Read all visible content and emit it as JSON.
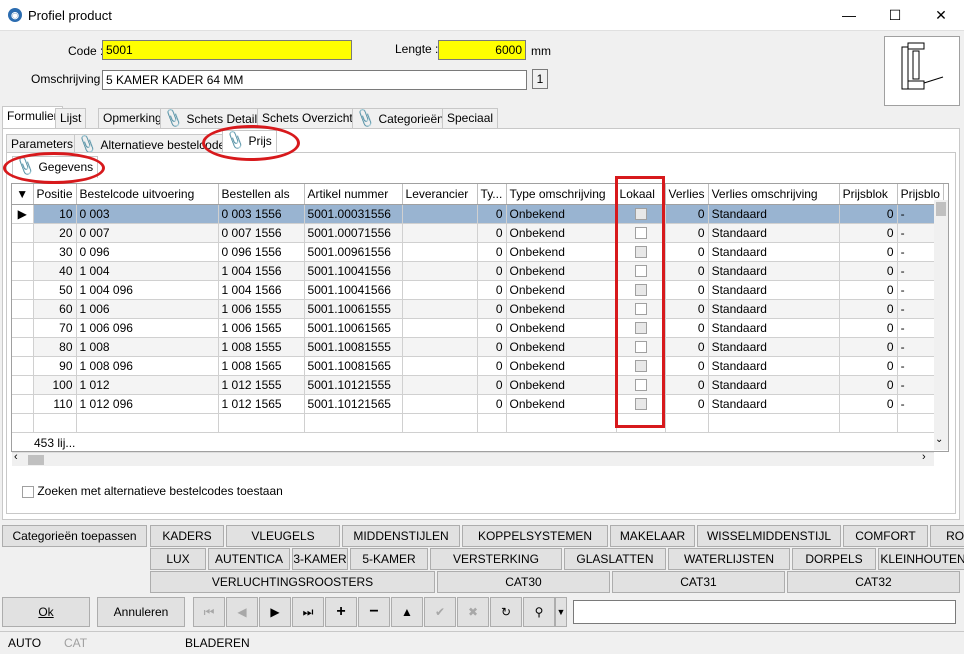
{
  "window": {
    "title": "Profiel product",
    "app_icon": "product-app-icon"
  },
  "header": {
    "code_label": "Code :",
    "code_value": "5001",
    "lengte_label": "Lengte :",
    "lengte_value": "6000",
    "lengte_unit": "mm",
    "omschrijving_label": "Omschrijving :",
    "omschrijving_value": "5 KAMER KADER 64 MM",
    "counter": "1"
  },
  "tabs": [
    "Formulier",
    "Lijst",
    "Opmerking",
    "Schets Detail",
    "Schets Overzicht",
    "Categorieën",
    "Speciaal"
  ],
  "subtabs": [
    "Parameters",
    "Alternatieve bestelcodes",
    "Prijs"
  ],
  "subsubtab": "Gegevens",
  "grid": {
    "columns": [
      "Positie",
      "Bestelcode uitvoering",
      "Bestellen als",
      "Artikel nummer",
      "Leverancier",
      "Ty...",
      "Type omschrijving",
      "Lokaal",
      "Verlies",
      "Verlies omschrijving",
      "Prijsblok",
      "Prijsblo"
    ],
    "rows": [
      {
        "pos": "10",
        "code": "0 003",
        "bestel": "0 003 1556",
        "art": "5001.00031556",
        "lev": "",
        "ty": "0",
        "type": "Onbekend",
        "verlies": "0",
        "vom": "Standaard",
        "prijsblok": "0",
        "pb2": "-"
      },
      {
        "pos": "20",
        "code": "0 007",
        "bestel": "0 007 1556",
        "art": "5001.00071556",
        "lev": "",
        "ty": "0",
        "type": "Onbekend",
        "verlies": "0",
        "vom": "Standaard",
        "prijsblok": "0",
        "pb2": "-"
      },
      {
        "pos": "30",
        "code": "0 096",
        "bestel": "0 096 1556",
        "art": "5001.00961556",
        "lev": "",
        "ty": "0",
        "type": "Onbekend",
        "verlies": "0",
        "vom": "Standaard",
        "prijsblok": "0",
        "pb2": "-"
      },
      {
        "pos": "40",
        "code": "1 004",
        "bestel": "1 004 1556",
        "art": "5001.10041556",
        "lev": "",
        "ty": "0",
        "type": "Onbekend",
        "verlies": "0",
        "vom": "Standaard",
        "prijsblok": "0",
        "pb2": "-"
      },
      {
        "pos": "50",
        "code": "1 004 096",
        "bestel": "1 004 1566",
        "art": "5001.10041566",
        "lev": "",
        "ty": "0",
        "type": "Onbekend",
        "verlies": "0",
        "vom": "Standaard",
        "prijsblok": "0",
        "pb2": "-"
      },
      {
        "pos": "60",
        "code": "1 006",
        "bestel": "1 006 1555",
        "art": "5001.10061555",
        "lev": "",
        "ty": "0",
        "type": "Onbekend",
        "verlies": "0",
        "vom": "Standaard",
        "prijsblok": "0",
        "pb2": "-"
      },
      {
        "pos": "70",
        "code": "1 006 096",
        "bestel": "1 006 1565",
        "art": "5001.10061565",
        "lev": "",
        "ty": "0",
        "type": "Onbekend",
        "verlies": "0",
        "vom": "Standaard",
        "prijsblok": "0",
        "pb2": "-"
      },
      {
        "pos": "80",
        "code": "1 008",
        "bestel": "1 008 1555",
        "art": "5001.10081555",
        "lev": "",
        "ty": "0",
        "type": "Onbekend",
        "verlies": "0",
        "vom": "Standaard",
        "prijsblok": "0",
        "pb2": "-"
      },
      {
        "pos": "90",
        "code": "1 008 096",
        "bestel": "1 008 1565",
        "art": "5001.10081565",
        "lev": "",
        "ty": "0",
        "type": "Onbekend",
        "verlies": "0",
        "vom": "Standaard",
        "prijsblok": "0",
        "pb2": "-"
      },
      {
        "pos": "100",
        "code": "1 012",
        "bestel": "1 012 1555",
        "art": "5001.10121555",
        "lev": "",
        "ty": "0",
        "type": "Onbekend",
        "verlies": "0",
        "vom": "Standaard",
        "prijsblok": "0",
        "pb2": "-"
      },
      {
        "pos": "110",
        "code": "1 012 096",
        "bestel": "1 012 1565",
        "art": "5001.10121565",
        "lev": "",
        "ty": "0",
        "type": "Onbekend",
        "verlies": "0",
        "vom": "Standaard",
        "prijsblok": "0",
        "pb2": "-"
      }
    ],
    "count": "453 lij..."
  },
  "search_alt_label": "Zoeken met alternatieve bestelcodes toestaan",
  "categories": {
    "apply_label": "Categorieën toepassen",
    "row1": [
      "KADERS",
      "VLEUGELS",
      "MIDDENSTIJLEN",
      "KOPPELSYSTEMEN",
      "MAKELAAR",
      "WISSELMIDDENSTIJL",
      "COMFORT",
      "ROYAL"
    ],
    "row2": [
      "LUX",
      "AUTENTICA",
      "3-KAMER",
      "5-KAMER",
      "VERSTERKING",
      "GLASLATTEN",
      "WATERLIJSTEN",
      "DORPELS",
      "KLEINHOUTEN"
    ],
    "row3": [
      "VERLUCHTINGSROOSTERS",
      "CAT30",
      "CAT31",
      "CAT32"
    ]
  },
  "buttons": {
    "ok": "Ok",
    "cancel": "Annuleren"
  },
  "status": {
    "mode": "AUTO",
    "cat": "CAT",
    "state": "BLADEREN"
  },
  "colors": {
    "highlight": "#ffff00",
    "selection": "#99b4d1",
    "annotation": "#d7191c"
  }
}
